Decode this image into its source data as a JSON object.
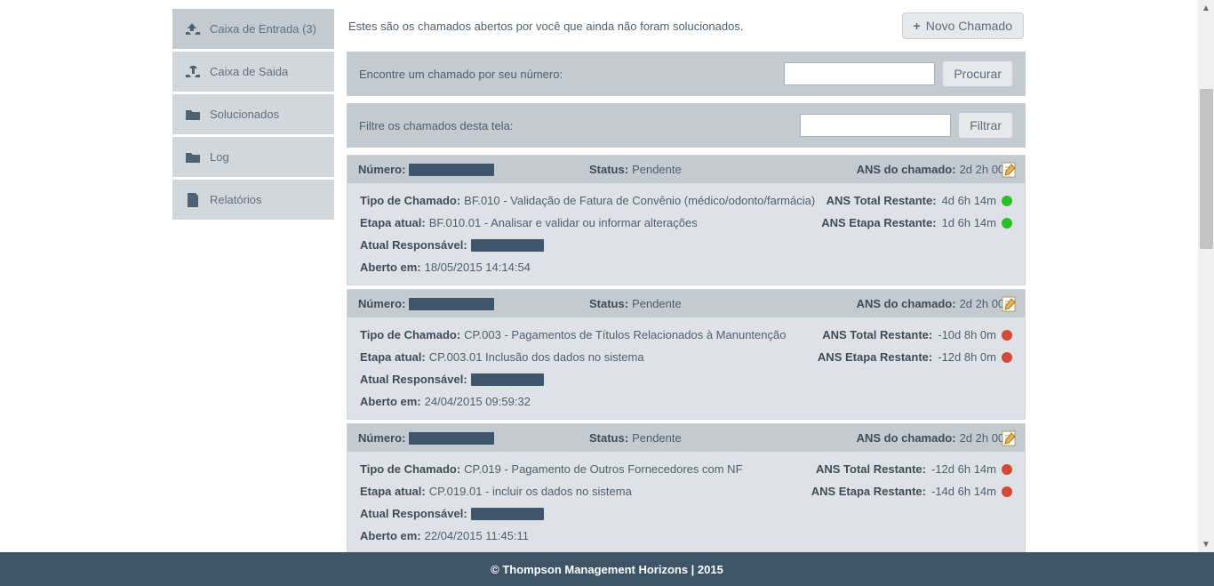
{
  "sidebar": {
    "items": [
      {
        "label": "Caixa de Entrada (3)",
        "icon": "inbox-icon"
      },
      {
        "label": "Caixa de Saida",
        "icon": "outbox-icon"
      },
      {
        "label": "Solucionados",
        "icon": "folder-icon"
      },
      {
        "label": "Log",
        "icon": "folder-icon"
      },
      {
        "label": "Relatórios",
        "icon": "report-icon"
      }
    ]
  },
  "top": {
    "intro": "Estes são os chamados abertos por você que ainda não foram solucionados.",
    "novo_chamado": "Novo Chamado"
  },
  "searchbar": {
    "find_label": "Encontre um chamado por seu número:",
    "find_button": "Procurar",
    "filter_label": "Filtre os chamados desta tela:",
    "filter_button": "Filtrar"
  },
  "labels": {
    "numero": "Número:",
    "status": "Status:",
    "ans_chamado": "ANS do chamado:",
    "tipo_chamado": "Tipo de Chamado:",
    "etapa_atual": "Etapa atual:",
    "ans_total": "ANS Total Restante:",
    "ans_etapa": "ANS Etapa Restante:",
    "atual_resp": "Atual Responsável:",
    "aberto_em": "Aberto em:"
  },
  "tickets": [
    {
      "status": "Pendente",
      "ans_chamado": "2d 2h 00m",
      "tipo": "BF.010 - Validação de Fatura de Convênio (médico/odonto/farmácia)",
      "etapa": "BF.010.01 - Analisar e validar ou informar alterações",
      "ans_total": "4d 6h 14m",
      "ans_etapa": "1d 6h 14m",
      "dot_total": "green",
      "dot_etapa": "green",
      "aberto": "18/05/2015 14:14:54"
    },
    {
      "status": "Pendente",
      "ans_chamado": "2d 2h 00m",
      "tipo": "CP.003 - Pagamentos de Títulos Relacionados à Manuntenção",
      "etapa": "CP.003.01 Inclusão dos dados no sistema",
      "ans_total": "-10d 8h 0m",
      "ans_etapa": "-12d 8h 0m",
      "dot_total": "red",
      "dot_etapa": "red",
      "aberto": "24/04/2015 09:59:32"
    },
    {
      "status": "Pendente",
      "ans_chamado": "2d 2h 00m",
      "tipo": "CP.019 - Pagamento de Outros Fornecedores com NF",
      "etapa": "CP.019.01 - incluir os dados no sistema",
      "ans_total": "-12d 6h 14m",
      "ans_etapa": "-14d 6h 14m",
      "dot_total": "red",
      "dot_etapa": "red",
      "aberto": "22/04/2015 11:45:11"
    }
  ],
  "footer": {
    "text": "© Thompson Management Horizons | 2015"
  }
}
